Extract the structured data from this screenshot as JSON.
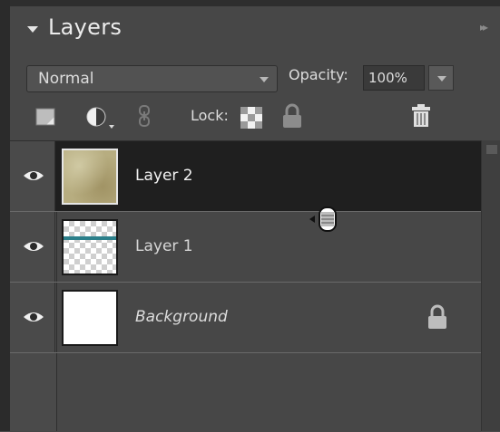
{
  "panel": {
    "title": "Layers",
    "menu_glyph": "▸▸"
  },
  "toolbar": {
    "blend_mode": "Normal",
    "opacity_label": "Opacity:",
    "opacity_value": "100%",
    "lock_label": "Lock:"
  },
  "layers": [
    {
      "name": "Layer 2",
      "selected": true,
      "thumbnail": "parchment"
    },
    {
      "name": "Layer 1",
      "selected": false,
      "thumbnail": "transparent-with-stripe"
    },
    {
      "name": "Background",
      "selected": false,
      "thumbnail": "white",
      "locked": true
    }
  ],
  "icons": {
    "collapse": "triangle-down-icon",
    "new_layer": "new-layer-icon",
    "adjustment": "adjustment-layer-icon",
    "link": "link-layers-icon",
    "lock_transparent": "lock-transparent-pixels-icon",
    "lock_all": "lock-all-icon",
    "delete": "trash-icon",
    "visibility": "eye-icon",
    "cursor": "drag-hand-cursor-icon"
  },
  "colors": {
    "panel_bg": "#474747",
    "selected_row": "#1f1f1f",
    "stripe": "#2b7f8a"
  }
}
